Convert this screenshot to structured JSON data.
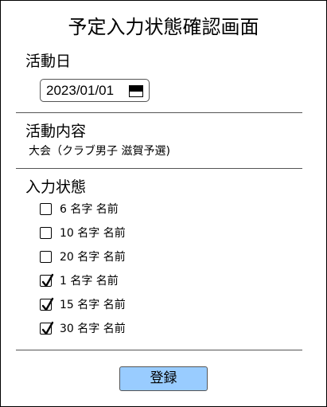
{
  "title": "予定入力状態確認画面",
  "activity_date": {
    "label": "活動日",
    "value": "2023/01/01",
    "icon": "calendar-icon"
  },
  "activity_content": {
    "label": "活動内容",
    "value": "大会（クラブ男子 滋賀予選)"
  },
  "input_status": {
    "label": "入力状態",
    "members": [
      {
        "label": "6 名字 名前",
        "checked": false
      },
      {
        "label": "10 名字 名前",
        "checked": false
      },
      {
        "label": "20 名字 名前",
        "checked": false
      },
      {
        "label": "1 名字 名前",
        "checked": true
      },
      {
        "label": "15 名字 名前",
        "checked": true
      },
      {
        "label": "30 名字 名前",
        "checked": true
      }
    ]
  },
  "register_button": {
    "label": "登録",
    "color": "#99ccff"
  }
}
